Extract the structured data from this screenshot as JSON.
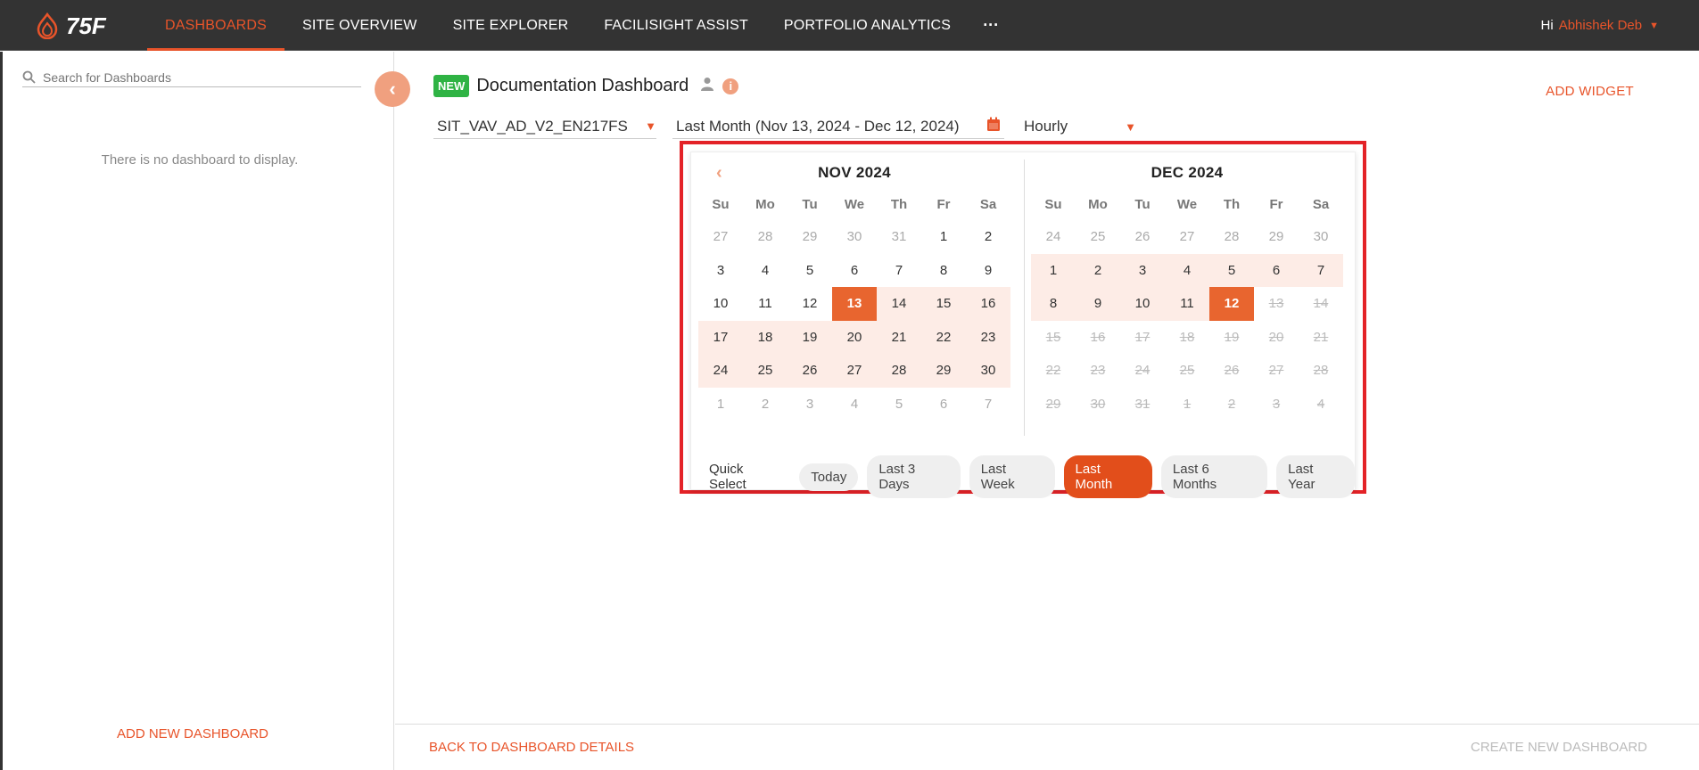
{
  "app": {
    "logo_text": "75F"
  },
  "nav": {
    "items": [
      {
        "label": "DASHBOARDS",
        "active": true
      },
      {
        "label": "SITE OVERVIEW"
      },
      {
        "label": "SITE EXPLORER"
      },
      {
        "label": "FACILISIGHT ASSIST"
      },
      {
        "label": "PORTFOLIO ANALYTICS"
      }
    ],
    "more": "···",
    "greeting": "Hi",
    "user": "Abhishek Deb"
  },
  "sidebar": {
    "search_placeholder": "Search for Dashboards",
    "empty_message": "There is no dashboard to display.",
    "add_dashboard": "ADD NEW DASHBOARD"
  },
  "header": {
    "badge": "NEW",
    "title": "Documentation Dashboard",
    "add_widget": "ADD WIDGET"
  },
  "filters": {
    "equipment": "SIT_VAV_AD_V2_EN217FS",
    "date_range": "Last Month (Nov 13, 2024 - Dec 12, 2024)",
    "interval": "Hourly"
  },
  "calendar": {
    "weekdays": [
      "Su",
      "Mo",
      "Tu",
      "We",
      "Th",
      "Fr",
      "Sa"
    ],
    "months": [
      {
        "title": "NOV 2024",
        "days": [
          {
            "d": "27",
            "s": "muted"
          },
          {
            "d": "28",
            "s": "muted"
          },
          {
            "d": "29",
            "s": "muted"
          },
          {
            "d": "30",
            "s": "muted"
          },
          {
            "d": "31",
            "s": "muted"
          },
          {
            "d": "1",
            "s": ""
          },
          {
            "d": "2",
            "s": ""
          },
          {
            "d": "3",
            "s": ""
          },
          {
            "d": "4",
            "s": ""
          },
          {
            "d": "5",
            "s": ""
          },
          {
            "d": "6",
            "s": ""
          },
          {
            "d": "7",
            "s": ""
          },
          {
            "d": "8",
            "s": ""
          },
          {
            "d": "9",
            "s": ""
          },
          {
            "d": "10",
            "s": ""
          },
          {
            "d": "11",
            "s": ""
          },
          {
            "d": "12",
            "s": ""
          },
          {
            "d": "13",
            "s": "sel"
          },
          {
            "d": "14",
            "s": "range"
          },
          {
            "d": "15",
            "s": "range"
          },
          {
            "d": "16",
            "s": "range"
          },
          {
            "d": "17",
            "s": "range"
          },
          {
            "d": "18",
            "s": "range"
          },
          {
            "d": "19",
            "s": "range"
          },
          {
            "d": "20",
            "s": "range"
          },
          {
            "d": "21",
            "s": "range"
          },
          {
            "d": "22",
            "s": "range"
          },
          {
            "d": "23",
            "s": "range"
          },
          {
            "d": "24",
            "s": "range"
          },
          {
            "d": "25",
            "s": "range"
          },
          {
            "d": "26",
            "s": "range"
          },
          {
            "d": "27",
            "s": "range"
          },
          {
            "d": "28",
            "s": "range"
          },
          {
            "d": "29",
            "s": "range"
          },
          {
            "d": "30",
            "s": "range"
          },
          {
            "d": "1",
            "s": "muted"
          },
          {
            "d": "2",
            "s": "muted"
          },
          {
            "d": "3",
            "s": "muted"
          },
          {
            "d": "4",
            "s": "muted"
          },
          {
            "d": "5",
            "s": "muted"
          },
          {
            "d": "6",
            "s": "muted"
          },
          {
            "d": "7",
            "s": "muted"
          }
        ]
      },
      {
        "title": "DEC 2024",
        "days": [
          {
            "d": "24",
            "s": "muted"
          },
          {
            "d": "25",
            "s": "muted"
          },
          {
            "d": "26",
            "s": "muted"
          },
          {
            "d": "27",
            "s": "muted"
          },
          {
            "d": "28",
            "s": "muted"
          },
          {
            "d": "29",
            "s": "muted"
          },
          {
            "d": "30",
            "s": "muted"
          },
          {
            "d": "1",
            "s": "range"
          },
          {
            "d": "2",
            "s": "range"
          },
          {
            "d": "3",
            "s": "range"
          },
          {
            "d": "4",
            "s": "range"
          },
          {
            "d": "5",
            "s": "range"
          },
          {
            "d": "6",
            "s": "range"
          },
          {
            "d": "7",
            "s": "range"
          },
          {
            "d": "8",
            "s": "range"
          },
          {
            "d": "9",
            "s": "range"
          },
          {
            "d": "10",
            "s": "range"
          },
          {
            "d": "11",
            "s": "range"
          },
          {
            "d": "12",
            "s": "sel"
          },
          {
            "d": "13",
            "s": "strike"
          },
          {
            "d": "14",
            "s": "strike"
          },
          {
            "d": "15",
            "s": "strike"
          },
          {
            "d": "16",
            "s": "strike"
          },
          {
            "d": "17",
            "s": "strike"
          },
          {
            "d": "18",
            "s": "strike"
          },
          {
            "d": "19",
            "s": "strike"
          },
          {
            "d": "20",
            "s": "strike"
          },
          {
            "d": "21",
            "s": "strike"
          },
          {
            "d": "22",
            "s": "strike"
          },
          {
            "d": "23",
            "s": "strike"
          },
          {
            "d": "24",
            "s": "strike"
          },
          {
            "d": "25",
            "s": "strike"
          },
          {
            "d": "26",
            "s": "strike"
          },
          {
            "d": "27",
            "s": "strike"
          },
          {
            "d": "28",
            "s": "strike"
          },
          {
            "d": "29",
            "s": "strike"
          },
          {
            "d": "30",
            "s": "strike"
          },
          {
            "d": "31",
            "s": "strike"
          },
          {
            "d": "1",
            "s": "strike"
          },
          {
            "d": "2",
            "s": "strike"
          },
          {
            "d": "3",
            "s": "strike"
          },
          {
            "d": "4",
            "s": "strike"
          }
        ]
      }
    ],
    "quick_label": "Quick Select",
    "quick_options": [
      {
        "label": "Today"
      },
      {
        "label": "Last 3 Days"
      },
      {
        "label": "Last Week"
      },
      {
        "label": "Last Month",
        "active": true
      },
      {
        "label": "Last 6 Months"
      },
      {
        "label": "Last Year"
      }
    ]
  },
  "footer": {
    "back": "BACK TO DASHBOARD DETAILS",
    "create": "CREATE NEW DASHBOARD"
  },
  "colors": {
    "accent": "#e8542a",
    "topbar": "#333333",
    "highlight_border": "#e32227",
    "new_badge": "#2fb344"
  }
}
